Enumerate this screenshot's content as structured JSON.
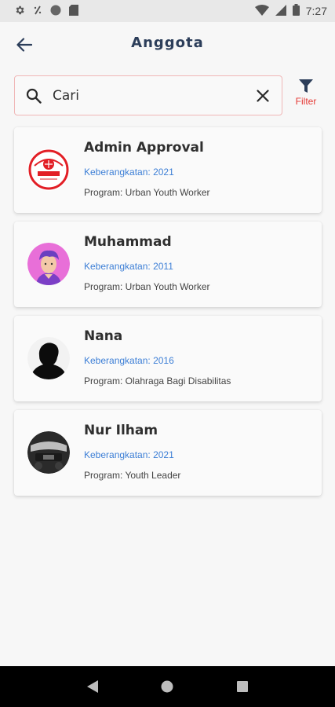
{
  "status_bar": {
    "time": "7:27",
    "icons": [
      "settings-icon",
      "do-not-disturb-icon",
      "record-icon",
      "sd-card-icon",
      "wifi-icon",
      "signal-icon",
      "battery-icon"
    ]
  },
  "app_bar": {
    "title": "Anggota",
    "back_icon": "arrow-left-icon"
  },
  "search": {
    "placeholder": "Cari",
    "value": "",
    "icon": "search-icon",
    "clear_icon": "close-icon"
  },
  "filter": {
    "label": "Filter",
    "icon": "filter-icon"
  },
  "members": [
    {
      "name": "Admin Approval",
      "year": "Keberangkatan: 2021",
      "program": "Program: Urban Youth Worker",
      "avatar": "kappija-logo"
    },
    {
      "name": "Muhammad",
      "year": "Keberangkatan: 2011",
      "program": "Program: Urban Youth Worker",
      "avatar": "cartoon-person"
    },
    {
      "name": "Nana",
      "year": "Keberangkatan: 2016",
      "program": "Program: Olahraga Bagi Disabilitas",
      "avatar": "silhouette"
    },
    {
      "name": "Nur Ilham",
      "year": "Keberangkatan: 2021",
      "program": "Program: Youth Leader",
      "avatar": "car-interior-photo"
    }
  ],
  "colors": {
    "title": "#2c3e5a",
    "year_text": "#3d7fd6",
    "filter_accent": "#e53935",
    "search_border": "#f0b7b7"
  },
  "nav_bar": {
    "buttons": [
      "back-triangle-icon",
      "home-circle-icon",
      "recents-square-icon"
    ]
  }
}
